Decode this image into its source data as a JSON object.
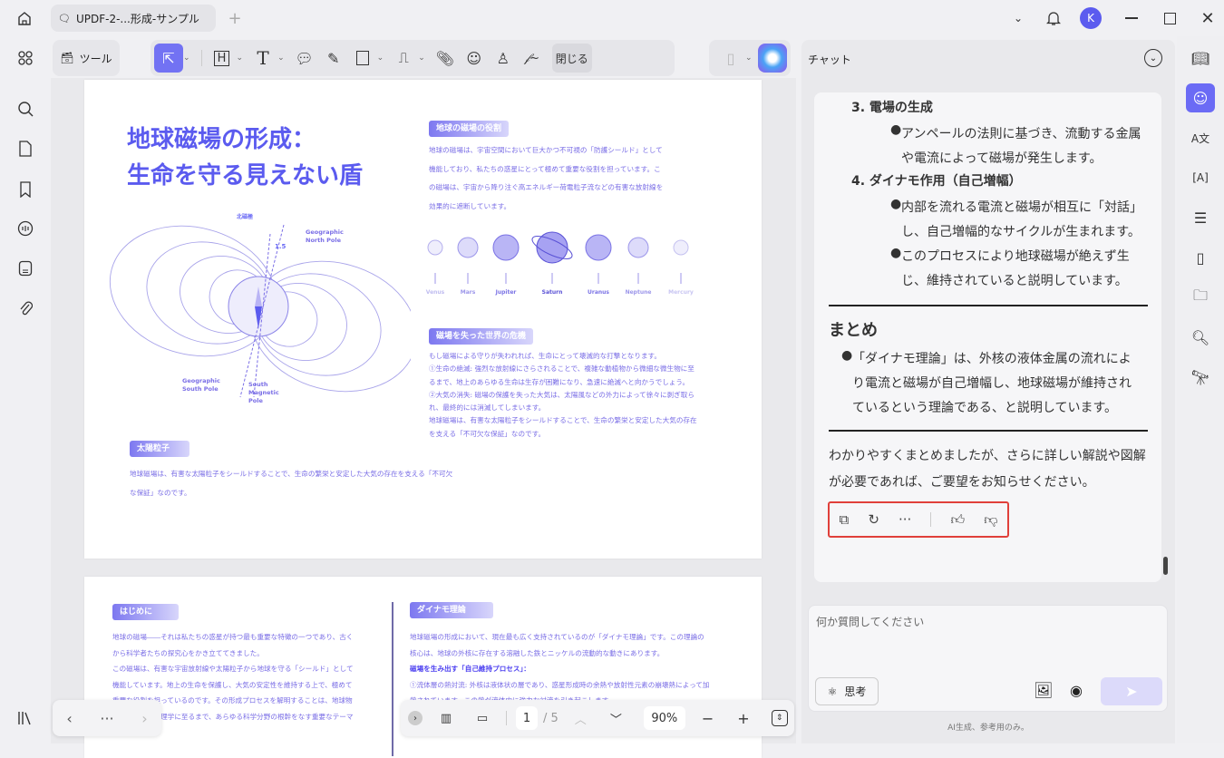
{
  "window": {
    "tab_title": "UPDF-2-...形成-サンプル",
    "avatar_letter": "K"
  },
  "toolbar": {
    "tools_label": "ツール",
    "close_label": "閉じる"
  },
  "page1": {
    "title_line1": "地球磁場の形成：",
    "title_line2": "生命を守る見えない盾",
    "diagram": {
      "top_label": "北磁極",
      "angle": "1.5",
      "north_pole": [
        "Geographic",
        "North Pole"
      ],
      "south_pole": [
        "Geographic",
        "South Pole"
      ],
      "south_magnetic": [
        "South",
        "Magnetic",
        "Pole"
      ]
    },
    "section1": {
      "heading": "地球の磁場の役割",
      "lines": [
        "地球の磁場は、宇宙空間において巨大かつ不可視の「防護シールド」として",
        "機能しており、私たちの惑星にとって極めて重要な役割を担っています。こ",
        "の磁場は、宇宙から降り注ぐ高エネルギー荷電粒子流などの有害な放射線を",
        "効果的に遮断しています。"
      ]
    },
    "planets": [
      "Venus",
      "Mars",
      "Jupiter",
      "Saturn",
      "Uranus",
      "Neptune",
      "Mercury"
    ],
    "section2": {
      "heading": "磁場を失った世界の危機",
      "lines": [
        "もし磁場による守りが失われれば、生命にとって壊滅的な打撃となります。",
        "①生命の絶滅: 強烈な放射線にさらされることで、複雑な動植物から微細な微生物に至",
        "るまで、地上のあらゆる生命は生存が困難になり、急速に絶滅へと向かうでしょう。",
        "②大気の消失: 磁場の保護を失った大気は、太陽風などの外力によって徐々に剥ぎ取ら",
        "れ、最終的には消滅してしまいます。",
        "地球磁場は、有害な太陽粒子をシールドすることで、生命の繁栄と安定した大気の存在",
        "を支える「不可欠な保証」なのです。"
      ]
    },
    "section3": {
      "heading": "太陽粒子",
      "lines": [
        "地球磁場は、有害な太陽粒子をシールドすることで、生命の繁栄と安定した大気の存在を支える「不可欠",
        "な保証」なのです。"
      ]
    }
  },
  "page2": {
    "intro": {
      "heading": "はじめに",
      "lines": [
        "地球の磁場――それは私たちの惑星が持つ最も重要な特徴の一つであり、古く",
        "から科学者たちの探究心をかき立ててきました。",
        "この磁場は、有害な宇宙放射線や太陽粒子から地球を守る「シールド」として",
        "機能しています。地上の生命を保護し、大気の安定性を維持する上で、極めて",
        "重要な役割を担っているのです。その形成プロセスを解明することは、地球物",
        "理学から天体物理学に至るまで、あらゆる科学分野の根幹をなす重要なテーマ"
      ]
    },
    "dynamo": {
      "heading": "ダイナモ理論",
      "lines": [
        "地球磁場の形成において、現在最も広く支持されているのが「ダイナモ理論」です。この理論の",
        "核心は、地球の外核に存在する溶融した鉄とニッケルの流動的な動きにあります。"
      ],
      "subheading": "磁場を生み出す「自己維持プロセス」：",
      "lines2": [
        "①流体層の熱対流: 外核は液体状の層であり、惑星形成時の余熱や放射性元素の崩壊熱によって加",
        "熱されています。この熱が流体内に強力な対流を引き起こします。"
      ]
    }
  },
  "bottom_nav": {
    "page_current": "1",
    "page_total": "/ 5",
    "zoom": "90%"
  },
  "chat": {
    "title": "チャット",
    "item3_title": "3. 電場の生成",
    "item3_bullet": [
      "アンペールの法則に基づき、流動する金属",
      "や電流によって磁場が発生します。"
    ],
    "item4_title": "4. ダイナモ作用（自己増幅）",
    "item4_bullet1": [
      "内部を流れる電流と磁場が相互に「対話」",
      "し、自己増幅的なサイクルが生まれます。"
    ],
    "item4_bullet2": [
      "このプロセスにより地球磁場が絶えず生",
      "じ、維持されていると説明しています。"
    ],
    "summary_heading": "まとめ",
    "summary_bullet": [
      "「ダイナモ理論」は、外核の液体金属の流れによ",
      "り電流と磁場が自己増幅し、地球磁場が維持され",
      "ているという理論である、と説明しています。"
    ],
    "closing": [
      "わかりやすくまとめましたが、さらに詳しい解説や図解",
      "が必要であれば、ご要望をお知らせください。"
    ],
    "input_placeholder": "何か質問してください",
    "think_label": "思考",
    "disclaimer": "AI生成、参考用のみ。"
  },
  "colors": {
    "accent": "#6b6bf5",
    "doc_text": "#7a6ee6",
    "highlight_border": "#e0403a"
  }
}
